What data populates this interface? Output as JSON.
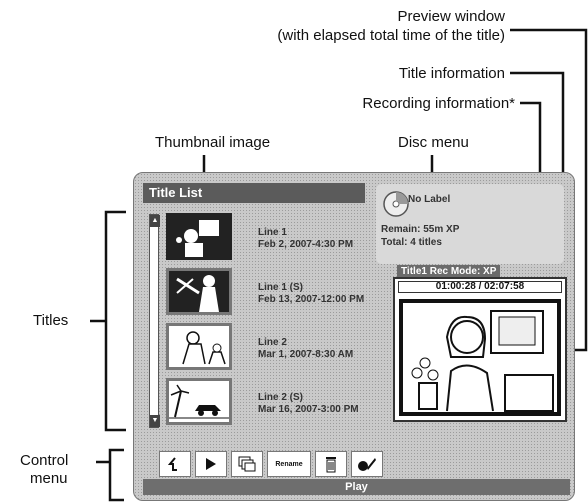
{
  "callouts": {
    "preview_window_1": "Preview window",
    "preview_window_2": "(with elapsed total time of the title)",
    "title_information": "Title information",
    "recording_information": "Recording information*",
    "thumbnail_image": "Thumbnail image",
    "disc_menu": "Disc menu",
    "titles": "Titles",
    "control_menu_1": "Control",
    "control_menu_2": "menu"
  },
  "ui": {
    "title_list_heading": "Title List",
    "disc": {
      "label": "No Label",
      "remain": "Remain: 55m  XP",
      "total": "Total: 4 titles"
    },
    "rec_line": "Title1 Rec Mode: XP",
    "elapsed": "01:00:28",
    "separator": "/",
    "total_time": "02:07:58",
    "titles": [
      {
        "name": "Line 1",
        "date": "Feb 2, 2007-4:30 PM"
      },
      {
        "name": "Line 1 (S)",
        "date": "Feb 13, 2007-12:00 PM"
      },
      {
        "name": "Line 2",
        "date": "Mar 1, 2007-8:30 AM"
      },
      {
        "name": "Line 2 (S)",
        "date": "Mar 16, 2007-3:00 PM"
      }
    ],
    "controls": {
      "up_icon": "up-arrow-icon",
      "play_icon": "play-icon",
      "pages_icon": "pages-icon",
      "rename": "Rename",
      "trash_icon": "trash-icon",
      "edit_icon": "edit-icon"
    },
    "play_label": "Play"
  }
}
